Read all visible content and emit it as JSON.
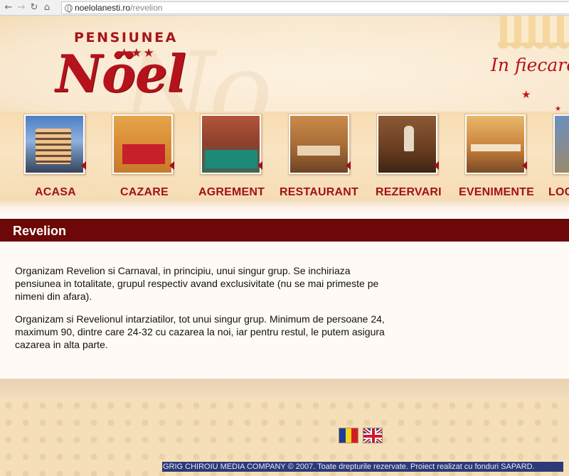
{
  "browser": {
    "back_icon": "back-arrow-icon",
    "forward_icon": "forward-arrow-icon",
    "reload_icon": "reload-icon",
    "home_icon": "home-icon",
    "back_glyph": "←",
    "forward_glyph": "→",
    "reload_glyph": "↻",
    "home_glyph": "⌂",
    "url_host": "noelolanesti.ro",
    "url_path": "/revelion"
  },
  "header": {
    "brand_top": "PENSIUNEA",
    "brand_stars": "★★★",
    "brand_name": "Nöel",
    "tagline": "In fiecare",
    "star_glyph": "★",
    "accent_color": "#b5121b"
  },
  "nav": {
    "items": [
      {
        "label": "ACASA",
        "image": "hotel-building-photo"
      },
      {
        "label": "CAZARE",
        "image": "bedroom-photo"
      },
      {
        "label": "AGREMENT",
        "image": "billiard-room-photo"
      },
      {
        "label": "RESTAURANT",
        "image": "restaurant-photo"
      },
      {
        "label": "REZERVARI",
        "image": "reception-photo"
      },
      {
        "label": "EVENIMENTE",
        "image": "event-hall-photo"
      },
      {
        "label": "LOC",
        "image": "location-photo"
      }
    ]
  },
  "section": {
    "title": "Revelion",
    "bar_color": "#6e0707"
  },
  "content": {
    "paragraph1": "Organizam Revelion si Carnaval, in principiu, unui singur grup. Se inchiriaza pensiunea in totalitate, grupul respectiv avand exclusivitate (nu se mai primeste pe nimeni din afara).",
    "paragraph2": "Organizam si Revelionul intarziatilor, tot unui singur grup. Minimum de persoane 24, maximum 90, dintre care 24-32 cu cazarea la noi, iar pentru restul, le putem asigura cazarea in alta parte."
  },
  "footer": {
    "languages": [
      "romanian-flag-icon",
      "english-flag-icon"
    ],
    "copyright": "GRIG CHIROIU MEDIA COMPANY © 2007. Toate drepturile rezervate. Proiect realizat cu fonduri SAPARD."
  }
}
